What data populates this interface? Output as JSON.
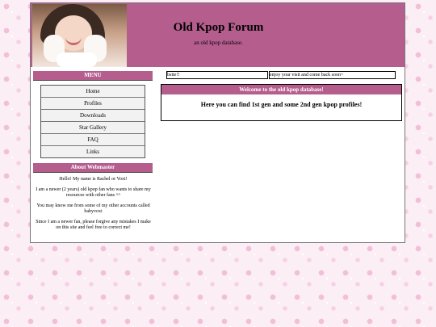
{
  "header": {
    "title": "Old Kpop Forum",
    "subtitle": "an old kpop database."
  },
  "sidebar": {
    "menu_heading": "MENU",
    "menu_items": [
      {
        "label": "Home"
      },
      {
        "label": "Profiles"
      },
      {
        "label": "Downloads"
      },
      {
        "label": "Star Gallery"
      },
      {
        "label": "FAQ"
      },
      {
        "label": "Links"
      }
    ],
    "about_heading": "About Webmaster",
    "about_paragraphs": [
      "Hello! My name is Rachel or Voxi!",
      "I am a newer (2 years) old kpop fan who wants to share my resources with other fans ^^",
      "You may know me from some of my other accounts called babyvoxi",
      "Since I am a newer fan, please forgive any mistakes I make on this site and feel free to correct me!"
    ]
  },
  "marquees": {
    "left_text": "bsite!!",
    "right_text": "enjoy your visit and come back soon~"
  },
  "welcome": {
    "heading": "Welcome to the old kpop database!",
    "body": "Here you can find 1st gen and some 2nd gen kpop profiles!"
  },
  "colors": {
    "accent": "#b55e8e",
    "background_pattern": "#f2bfd8"
  }
}
